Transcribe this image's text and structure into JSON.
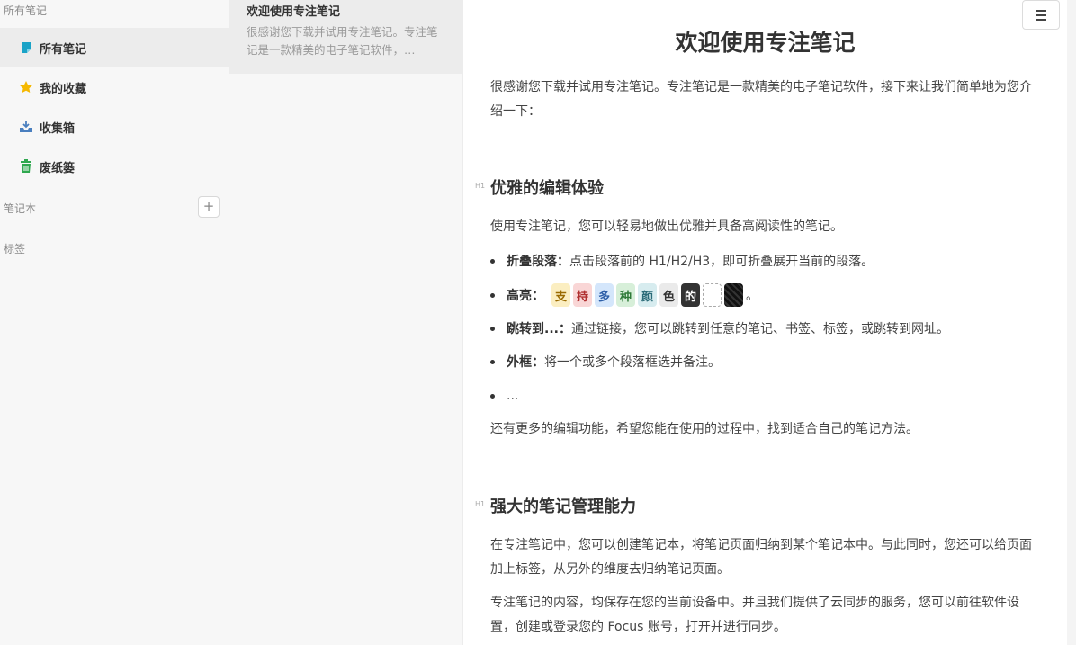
{
  "sidebar": {
    "section_all": "所有笔记",
    "items": [
      {
        "label": "所有笔记",
        "icon": "note-icon",
        "color": "#1aa3c7"
      },
      {
        "label": "我的收藏",
        "icon": "star-icon",
        "color": "#f5b800"
      },
      {
        "label": "收集箱",
        "icon": "inbox-icon",
        "color": "#4a7fbf"
      },
      {
        "label": "废纸篓",
        "icon": "trash-icon",
        "color": "#2fa84f"
      }
    ],
    "section_notebooks": "笔记本",
    "add_label": "+",
    "section_tags": "标签"
  },
  "note_list": {
    "notes": [
      {
        "title": "欢迎使用专注笔记",
        "snippet": "很感谢您下载并试用专注笔记。专注笔记是一款精美的电子笔记软件，…"
      }
    ]
  },
  "editor": {
    "title": "欢迎使用专注笔记",
    "intro": "很感谢您下载并试用专注笔记。专注笔记是一款精美的电子笔记软件，接下来让我们简单地为您介绍一下：",
    "h1_marker": "H1",
    "section1": {
      "heading": "优雅的编辑体验",
      "para": "使用专注笔记，您可以轻易地做出优雅并具备高阅读性的笔记。",
      "bullets": [
        {
          "bold": "折叠段落：",
          "text": "点击段落前的 H1/H2/H3，即可折叠展开当前的段落。"
        },
        {
          "bold": "高亮：",
          "text": ""
        },
        {
          "bold": "跳转到...：",
          "text": "通过链接，您可以跳转到任意的笔记、书签、标签，或跳转到网址。"
        },
        {
          "bold": "外框：",
          "text": "将一个或多个段落框选并备注。"
        },
        {
          "bold": "",
          "text": "..."
        }
      ],
      "highlights": [
        "支",
        "持",
        "多",
        "种",
        "颜",
        "色",
        "的"
      ],
      "highlight_end": "。",
      "outro": "还有更多的编辑功能，希望您能在使用的过程中，找到适合自己的笔记方法。"
    },
    "section2": {
      "heading": "强大的笔记管理能力",
      "para1": "在专注笔记中，您可以创建笔记本，将笔记页面归纳到某个笔记本中。与此同时，您还可以给页面加上标签，从另外的维度去归纳笔记页面。",
      "para2": "专注笔记的内容，均保存在您的当前设备中。并且我们提供了云同步的服务，您可以前往软件设置，创建或登录您的 Focus 账号，打开并进行同步。"
    },
    "menu_icon": "hamburger-icon"
  }
}
